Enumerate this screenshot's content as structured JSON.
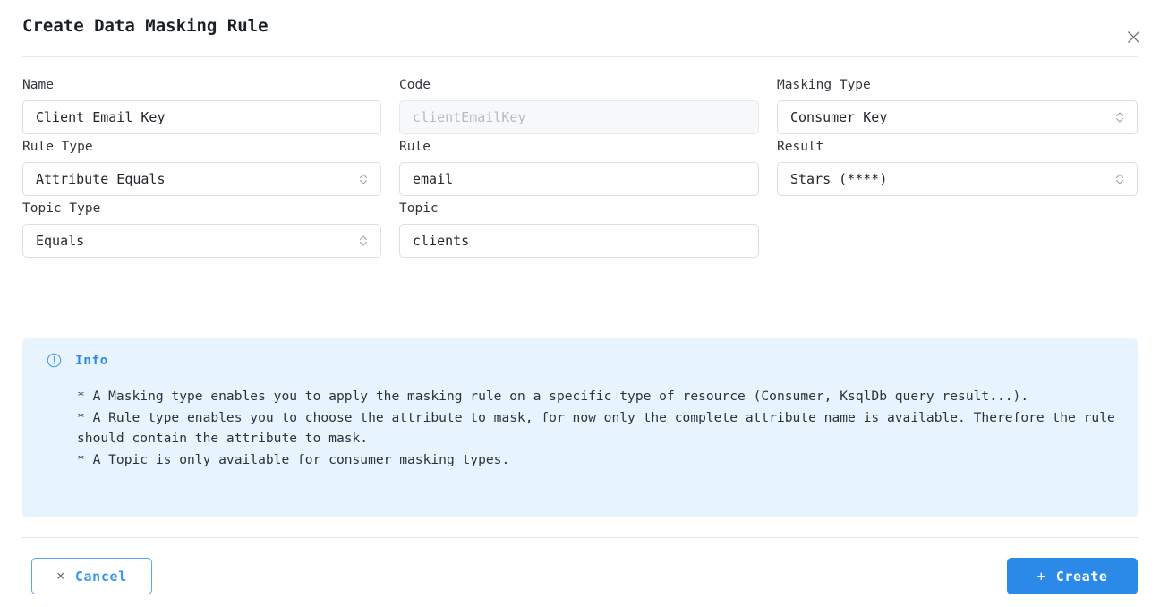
{
  "dialog": {
    "title": "Create Data Masking Rule",
    "close_icon": "close-icon"
  },
  "form": {
    "rows": [
      {
        "fields": [
          {
            "label": "Name",
            "kind": "text",
            "value": "Client Email Key",
            "placeholder": "",
            "disabled": false
          },
          {
            "label": "Code",
            "kind": "text",
            "value": "",
            "placeholder": "clientEmailKey",
            "disabled": true
          },
          {
            "label": "Masking Type",
            "kind": "select",
            "value": "Consumer Key",
            "placeholder": "",
            "disabled": false
          }
        ]
      },
      {
        "fields": [
          {
            "label": "Rule Type",
            "kind": "select",
            "value": "Attribute Equals",
            "placeholder": "",
            "disabled": false
          },
          {
            "label": "Rule",
            "kind": "text",
            "value": "email",
            "placeholder": "",
            "disabled": false
          },
          {
            "label": "Result",
            "kind": "select",
            "value": "Stars (****)",
            "placeholder": "",
            "disabled": false
          }
        ]
      },
      {
        "fields": [
          {
            "label": "Topic Type",
            "kind": "select",
            "value": "Equals",
            "placeholder": "",
            "disabled": false
          },
          {
            "label": "Topic",
            "kind": "text",
            "value": "clients",
            "placeholder": "",
            "disabled": false
          }
        ]
      }
    ],
    "labels": {
      "name": "Name",
      "code": "Code",
      "masking_type": "Masking Type",
      "rule_type": "Rule Type",
      "rule": "Rule",
      "result": "Result",
      "topic_type": "Topic Type",
      "topic": "Topic"
    },
    "values": {
      "name": "Client Email Key",
      "code_placeholder": "clientEmailKey",
      "masking_type": "Consumer Key",
      "rule_type": "Attribute Equals",
      "rule": "email",
      "result": "Stars (****)",
      "topic_type": "Equals",
      "topic": "clients"
    }
  },
  "info": {
    "icon": "exclamation-circle-icon",
    "title": "Info",
    "lines": [
      "* A Masking type enables you to apply the masking rule on a specific type of resource (Consumer, KsqlDb query result...).",
      "* A Rule type enables you to choose the attribute to mask, for now only the complete attribute name is available. Therefore the rule should contain the attribute to mask.",
      "* A Topic is only available for consumer masking types."
    ]
  },
  "footer": {
    "cancel_label": "Cancel",
    "cancel_glyph": "×",
    "create_label": "Create",
    "create_glyph": "+"
  },
  "colors": {
    "accent": "#2b8ae8",
    "info_bg": "#e8f4fd",
    "border": "#dcdfe4",
    "text": "#22272d",
    "disabled_bg": "#f7f8f9"
  }
}
